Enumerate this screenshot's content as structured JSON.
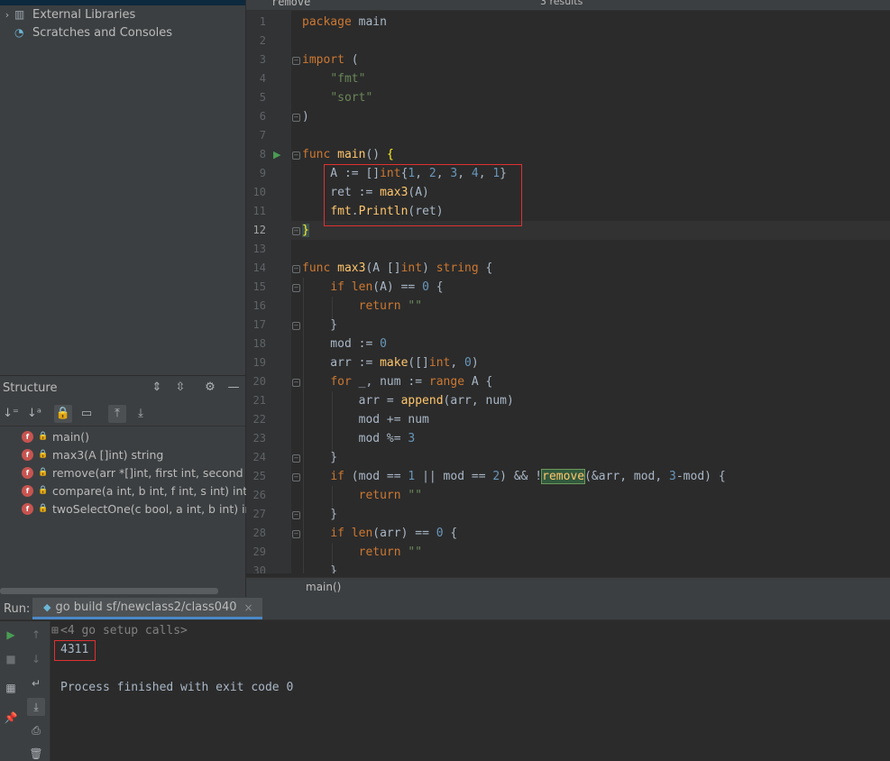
{
  "project_tree": {
    "items": [
      {
        "label": "External Libraries",
        "icon": "library-icon"
      },
      {
        "label": "Scratches and Consoles",
        "icon": "scratches-icon"
      }
    ]
  },
  "structure": {
    "title": "Structure",
    "items": [
      {
        "label": "main()"
      },
      {
        "label": "max3(A []int) string"
      },
      {
        "label": "remove(arr *[]int, first int, second int)"
      },
      {
        "label": "compare(a int, b int, f int, s int) int"
      },
      {
        "label": "twoSelectOne(c bool, a int, b int) int"
      }
    ],
    "icon_letter": "f"
  },
  "search": {
    "query": "remove",
    "results": "3 results"
  },
  "editor": {
    "line_numbers": [
      "1",
      "2",
      "3",
      "4",
      "5",
      "6",
      "7",
      "8",
      "9",
      "10",
      "11",
      "12",
      "13",
      "14",
      "15",
      "16",
      "17",
      "18",
      "19",
      "20",
      "21",
      "22",
      "23",
      "24",
      "25",
      "26",
      "27",
      "28",
      "29",
      "30"
    ],
    "current_line": "12",
    "breadcrumb": "main()"
  },
  "run": {
    "label": "Run:",
    "tab": "go build sf/newclass2/class040",
    "output": {
      "setup": "<4 go setup calls>",
      "result": "4311",
      "finished": "Process finished with exit code 0"
    }
  },
  "colors": {
    "keyword": "#cc7832",
    "string": "#6a8759",
    "number": "#6897bb",
    "function": "#ffc66d",
    "highlight_box": "#e03030"
  }
}
